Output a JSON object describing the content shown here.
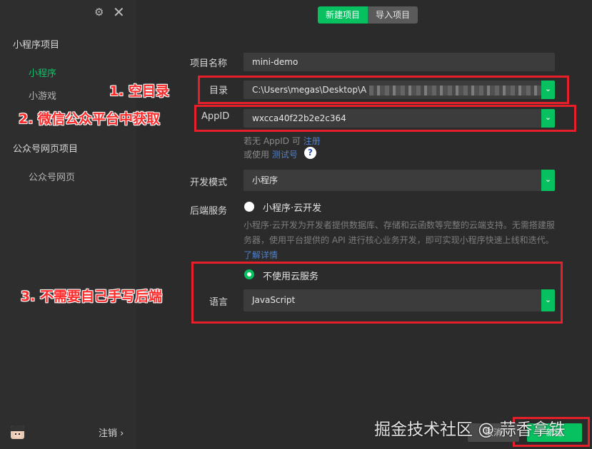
{
  "sidebar": {
    "icons": {
      "settings": "gear-icon",
      "close": "close-icon"
    },
    "sections": [
      {
        "title": "小程序项目",
        "items": [
          {
            "label": "小程序",
            "active": true
          },
          {
            "label": "小游戏",
            "active": false
          }
        ]
      },
      {
        "title": "公众号网页项目",
        "items": [
          {
            "label": "公众号网页",
            "active": false
          }
        ]
      }
    ],
    "footer": {
      "logout_label": "注销",
      "chevron": "›"
    }
  },
  "tabs": [
    {
      "label": "新建项目",
      "active": true
    },
    {
      "label": "导入项目",
      "active": false
    }
  ],
  "form": {
    "project_name": {
      "label": "项目名称",
      "value": "mini-demo"
    },
    "directory": {
      "label": "目录",
      "value": "C:\\Users\\megas\\Desktop\\A"
    },
    "appid": {
      "label": "AppID",
      "value": "wxcca40f22b2e2c364"
    },
    "appid_hint1": {
      "text": "若无 AppID 可",
      "link": "注册"
    },
    "appid_hint2": {
      "text": "或使用",
      "link": "测试号"
    },
    "help_glyph": "?",
    "dev_mode": {
      "label": "开发模式",
      "value": "小程序"
    },
    "backend": {
      "label": "后端服务",
      "option_cloud": {
        "label": "小程序·云开发",
        "selected": false
      },
      "description": "小程序·云开发为开发者提供数据库、存储和云函数等完整的云端支持。无需搭建服务器，使用平台提供的 API 进行核心业务开发，即可实现小程序快速上线和迭代。",
      "learn_more": "了解详情",
      "option_none": {
        "label": "不使用云服务",
        "selected": true
      }
    },
    "language": {
      "label": "语言",
      "value": "JavaScript"
    }
  },
  "annotations": {
    "a1": "1. 空目录",
    "a2": "2. 微信公众平台中获取",
    "a3": "3. 不需要自己手写后端",
    "color": "#e5202b"
  },
  "buttons": {
    "cancel": "取消",
    "create": "新建"
  },
  "watermark": "掘金技术社区 @ 蒜香拿铁",
  "colors": {
    "accent": "#07c160",
    "link": "#4f7fc7"
  }
}
